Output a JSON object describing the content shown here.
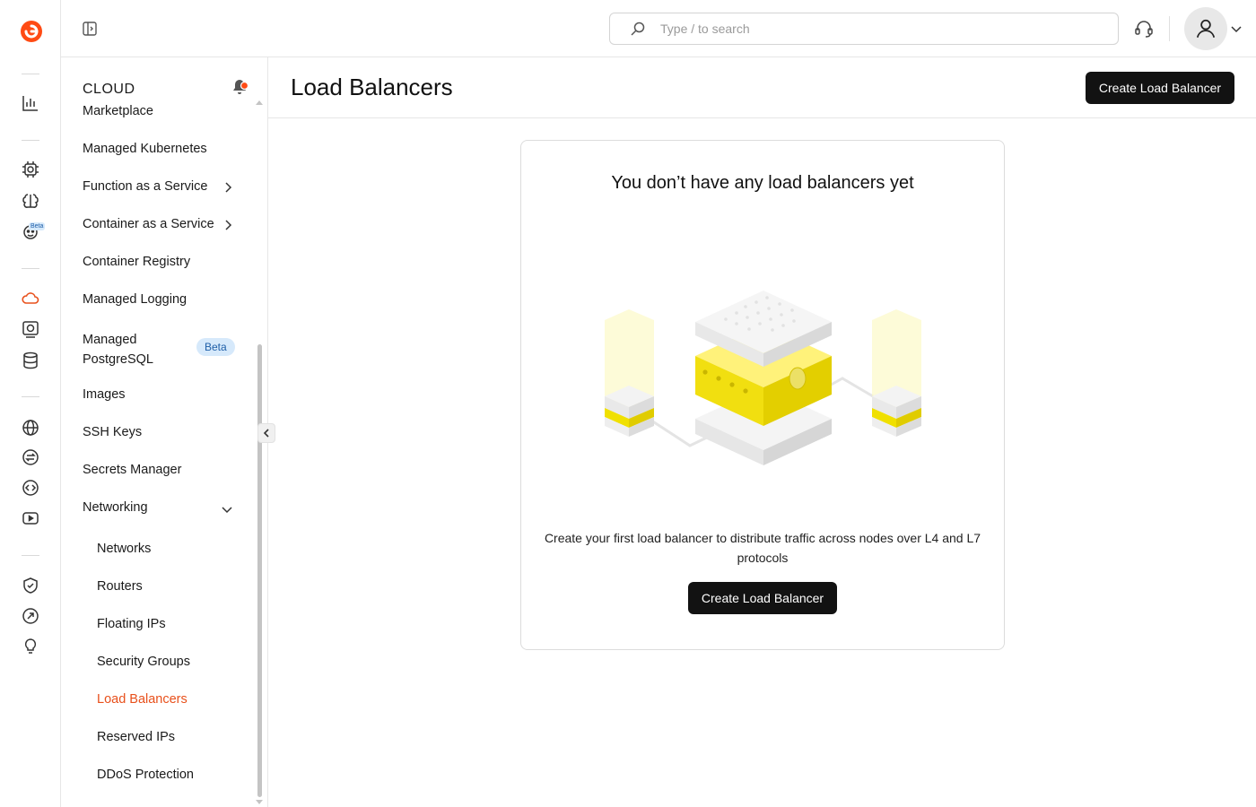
{
  "rail": {
    "icons": [
      "logo-icon",
      "analytics-icon",
      "gpu-chip-icon",
      "ai-brain-icon",
      "ai-bot-icon",
      "cloud-icon",
      "bare-metal-icon",
      "database-icon",
      "cdn-globe-icon",
      "transfer-icon",
      "code-icon",
      "video-icon",
      "security-shield-icon",
      "migration-icon",
      "ideas-bulb-icon"
    ],
    "beta_label": "Beta",
    "active_color": "#e8501b"
  },
  "topbar": {
    "search_placeholder": "Type / to search"
  },
  "sidebar": {
    "title": "CLOUD",
    "items": [
      {
        "label": "Marketplace"
      },
      {
        "label": "Managed Kubernetes"
      },
      {
        "label": "Function as a Service"
      },
      {
        "label": "Container as a Service"
      },
      {
        "label": "Container Registry"
      },
      {
        "label": "Managed Logging"
      },
      {
        "label": "Managed\nPostgreSQL",
        "badge": "Beta"
      },
      {
        "label": "Images"
      },
      {
        "label": "SSH Keys"
      },
      {
        "label": "Secrets Manager"
      },
      {
        "label": "Networking"
      }
    ],
    "networking_items": [
      {
        "label": "Networks"
      },
      {
        "label": "Routers"
      },
      {
        "label": "Floating IPs"
      },
      {
        "label": "Security Groups"
      },
      {
        "label": "Load Balancers",
        "active": true
      },
      {
        "label": "Reserved IPs"
      },
      {
        "label": "DDoS Protection"
      }
    ]
  },
  "page": {
    "title": "Load Balancers",
    "create_button": "Create Load Balancer"
  },
  "empty_state": {
    "title": "You don’t have any load balancers yet",
    "description": "Create your first load balancer to distribute traffic across nodes over L4 and L7 protocols",
    "button": "Create Load Balancer",
    "illustration_accent": "#f5e600"
  }
}
